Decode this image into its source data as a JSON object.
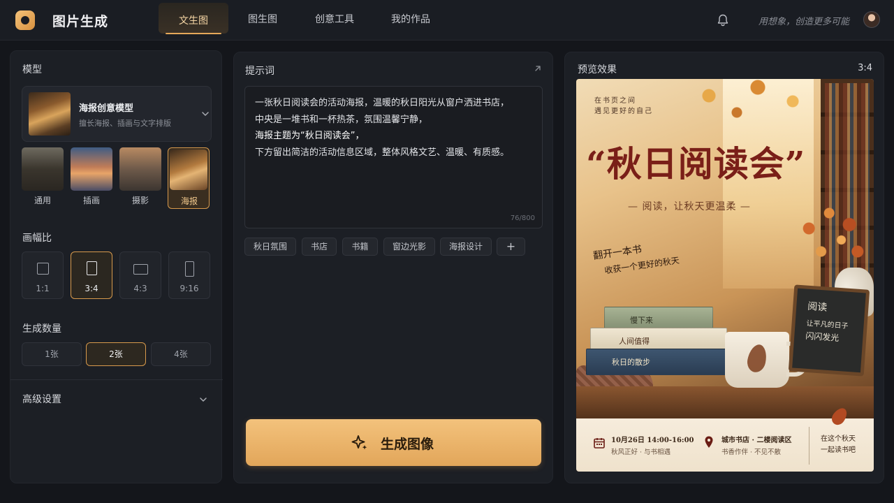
{
  "header": {
    "app_title": "图片生成",
    "tabs": [
      {
        "label": "文生图",
        "active": true
      },
      {
        "label": "图生图",
        "active": false
      },
      {
        "label": "创意工具",
        "active": false
      },
      {
        "label": "我的作品",
        "active": false
      }
    ],
    "slogan": "用想象，创造更多可能",
    "icons": {
      "logo": "app-logo",
      "bell": "bell-icon",
      "avatar": "user-avatar"
    }
  },
  "left": {
    "model_label": "模型",
    "model": {
      "name": "海报创意模型",
      "desc": "擅长海报、插画与文字排版"
    },
    "styles": [
      {
        "label": "通用",
        "active": false
      },
      {
        "label": "插画",
        "active": false
      },
      {
        "label": "摄影",
        "active": false
      },
      {
        "label": "海报",
        "active": true
      }
    ],
    "ratio_label": "画幅比",
    "ratios": [
      {
        "label": "1:1",
        "active": false
      },
      {
        "label": "3:4",
        "active": true
      },
      {
        "label": "4:3",
        "active": false
      },
      {
        "label": "9:16",
        "active": false
      }
    ],
    "count_label": "生成数量",
    "counts": [
      {
        "label": "1张",
        "active": false
      },
      {
        "label": "2张",
        "active": true
      },
      {
        "label": "4张",
        "active": false
      }
    ],
    "advanced_label": "高级设置"
  },
  "middle": {
    "prompt_label": "提示词",
    "prompt_lines": [
      "一张秋日阅读会的活动海报，温暖的秋日阳光从窗户洒进书店，",
      "中央是一堆书和一杯热茶，氛围温馨宁静，",
      "海报主题为“秋日阅读会”，",
      "下方留出简洁的活动信息区域，整体风格文艺、温暖、有质感。"
    ],
    "char_count": "76/800",
    "tags": [
      "秋日氛围",
      "书店",
      "书籍",
      "窗边光影",
      "海报设计",
      "+"
    ],
    "generate_label": "生成图像"
  },
  "right": {
    "preview_label": "预览效果",
    "ratio": "3:4",
    "poster": {
      "small_top_1": "在书页之间",
      "small_top_2": "遇见更好的自己",
      "title": "“秋日阅读会”",
      "subtitle": "— 阅读，让秋天更温柔 —",
      "side_1": "翻开一本书",
      "side_2": "收获一个更好的秋天",
      "books": [
        "慢下来",
        "人间值得",
        "秋日的散步"
      ],
      "chalk_1": "阅读",
      "chalk_2": "让平凡的日子",
      "chalk_3": "闪闪发光",
      "footer": {
        "date_main": "10月26日 14:00-16:00",
        "date_sub": "秋风正好 · 与书相遇",
        "place_main": "城市书店 · 二楼阅读区",
        "place_sub": "书香作伴 · 不见不散",
        "right_1": "在这个秋天",
        "right_2": "一起读书吧"
      }
    }
  },
  "colors": {
    "accent": "#e5a85a",
    "title_red": "#7a1f18",
    "bg": "#14161b",
    "panel": "#1c1f25"
  }
}
